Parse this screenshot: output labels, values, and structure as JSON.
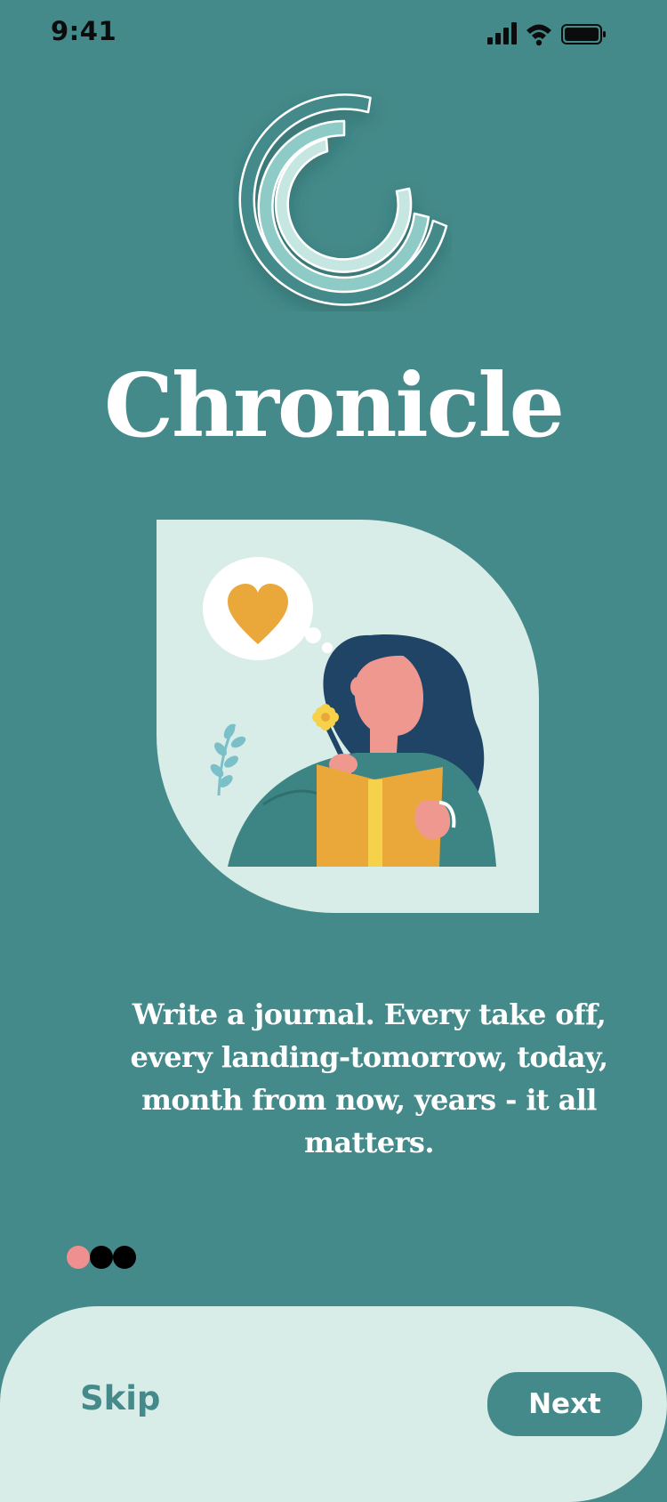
{
  "status_bar": {
    "time": "9:41",
    "icons": [
      "signal-icon",
      "wifi-icon",
      "battery-icon"
    ]
  },
  "app": {
    "name": "Chronicle",
    "logo_icon": "chronicle-logo"
  },
  "onboarding": {
    "illustration_icon": "woman-journaling-illustration",
    "tagline": "Write a journal. Every take off, every landing-tomorrow, today, month from now, years -  it all matters.",
    "page_dots": {
      "count": 3,
      "active_index": 0
    }
  },
  "actions": {
    "skip_label": "Skip",
    "next_label": "Next"
  },
  "colors": {
    "background": "#458a8a",
    "panel": "#d8ece8",
    "dot_active": "#f08f8f",
    "dot_inactive": "#000000",
    "accent_yellow": "#eaa83a",
    "hair_navy": "#1f4466",
    "skin": "#ef9890",
    "sweater": "#3d8585"
  }
}
